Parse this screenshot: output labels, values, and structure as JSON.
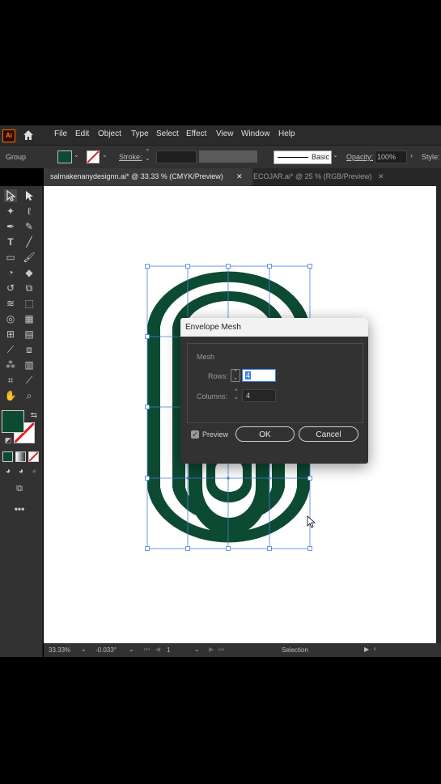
{
  "app": {
    "logo": "Ai",
    "home_icon": "home-icon"
  },
  "menu": [
    "File",
    "Edit",
    "Object",
    "Type",
    "Select",
    "Effect",
    "View",
    "Window",
    "Help"
  ],
  "control_bar": {
    "selection_label": "Group",
    "stroke_label": "Stroke:",
    "brush_label": "Basic",
    "opacity_label": "Opacity:",
    "opacity_value": "100%",
    "style_label": "Style:",
    "fill_color": "#0d4a32"
  },
  "tabs": [
    {
      "label": "salmakenanydesignn.ai* @ 33.33 % (CMYK/Preview)",
      "active": true
    },
    {
      "label": "ECOJAR.ai* @ 25 % (RGB/Preview)",
      "active": false
    }
  ],
  "status": {
    "zoom": "33.33%",
    "rotation": "-0.033°",
    "artboard": "1",
    "tool": "Selection"
  },
  "dialog": {
    "title": "Envelope Mesh",
    "section": "Mesh",
    "rows_label": "Rows:",
    "rows_value": "4",
    "columns_label": "Columns:",
    "columns_value": "4",
    "preview_label": "Preview",
    "preview_checked": true,
    "ok_label": "OK",
    "cancel_label": "Cancel"
  },
  "colors": {
    "artwork": "#0d4a32",
    "selection": "#4a7fd8"
  }
}
